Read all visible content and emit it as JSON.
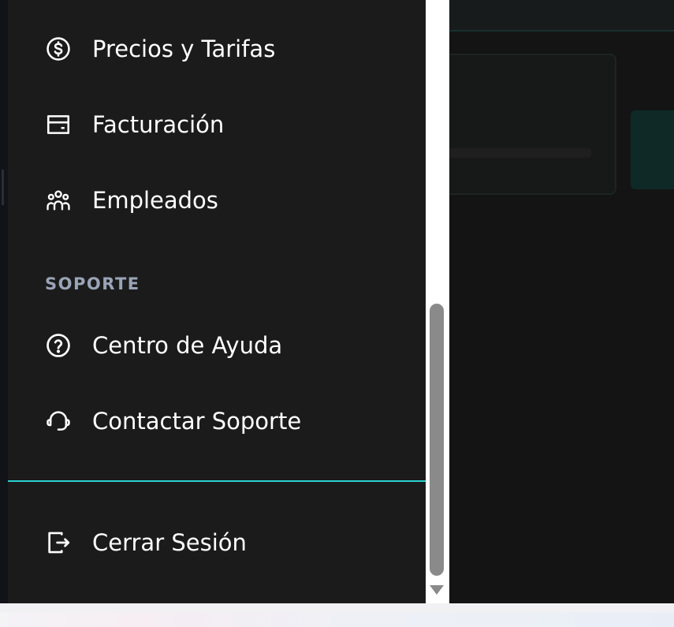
{
  "nav": {
    "items_top": [
      {
        "label": "Precios y Tarifas",
        "icon": "dollar-circle-icon"
      },
      {
        "label": "Facturación",
        "icon": "credit-card-icon"
      },
      {
        "label": "Empleados",
        "icon": "users-group-icon"
      }
    ],
    "support_section": {
      "title": "SOPORTE",
      "items": [
        {
          "label": "Centro de Ayuda",
          "icon": "help-circle-icon"
        },
        {
          "label": "Contactar Soporte",
          "icon": "headset-icon"
        }
      ]
    },
    "logout": {
      "label": "Cerrar Sesión",
      "icon": "logout-icon"
    }
  },
  "colors": {
    "drawer_bg": "#1b1b1b",
    "text": "#ffffff",
    "section_title": "#9aa4b6",
    "divider_accent": "#2ad2d2",
    "scrollbar_thumb": "#8a8a8a"
  }
}
